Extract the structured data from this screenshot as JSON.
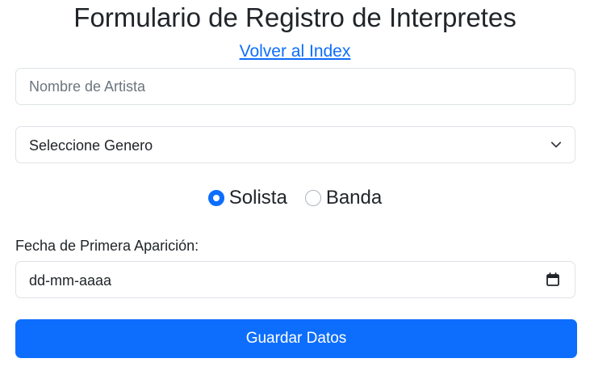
{
  "page": {
    "title": "Formulario de Registro de Interpretes",
    "back_link_label": "Volver al Index"
  },
  "form": {
    "artist_name": {
      "placeholder": "Nombre de Artista",
      "value": ""
    },
    "genre_select": {
      "selected": "Seleccione Genero",
      "icon": "chevron-down-icon"
    },
    "type_radio": {
      "options": [
        {
          "label": "Solista",
          "checked": true
        },
        {
          "label": "Banda",
          "checked": false
        }
      ]
    },
    "first_appearance": {
      "label": "Fecha de Primera Aparición:",
      "placeholder": "dd-mm-aaaa",
      "icon": "calendar-icon"
    },
    "submit_label": "Guardar Datos"
  },
  "colors": {
    "primary": "#0d6efd",
    "border": "#dee2e6",
    "text": "#212529",
    "placeholder": "#6c757d"
  }
}
